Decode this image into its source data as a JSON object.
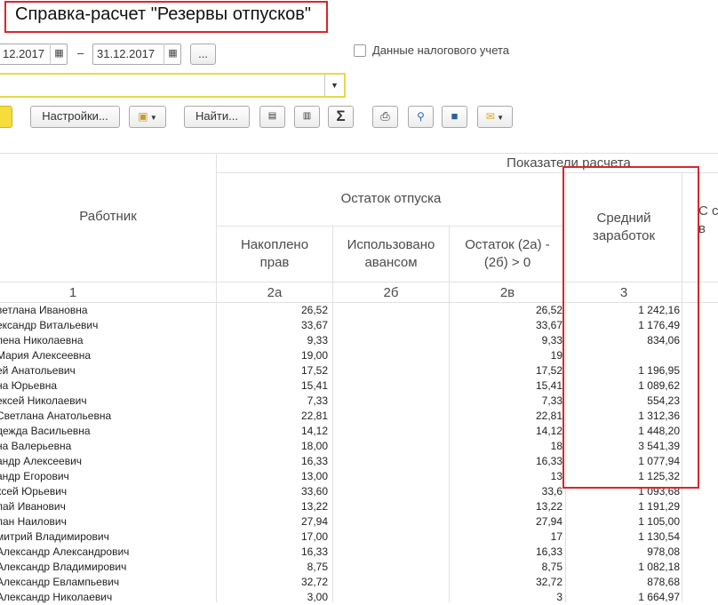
{
  "title": "Справка-расчет \"Резервы отпусков\"",
  "period": {
    "from": "12.2017",
    "dash": "–",
    "to": "31.12.2017",
    "more_label": "..."
  },
  "tax_checkbox_label": "Данные налогового учета",
  "toolbar": {
    "settings_label": "Настройки...",
    "find_label": "Найти...",
    "sum_label": "Σ"
  },
  "table": {
    "group_header": "Показатели расчета",
    "subgroup_header": "Остаток отпуска",
    "col_employee": "Работник",
    "col_accrued": "Накоплено прав",
    "col_used": "Использовано авансом",
    "col_balance": "Остаток (2а) - (2б) > 0",
    "col_avg": "Средний заработок",
    "col_cut": "С ст в",
    "num_employee": "1",
    "num_accrued": "2а",
    "num_used": "2б",
    "num_balance": "2в",
    "num_avg": "3",
    "rows": [
      {
        "name": "ветлана Ивановна",
        "accrued": "26,52",
        "balance": "26,52",
        "avg": "1 242,16"
      },
      {
        "name": "ександр Витальевич",
        "accrued": "33,67",
        "balance": "33,67",
        "avg": "1 176,49"
      },
      {
        "name": "лена Николаевна",
        "accrued": "9,33",
        "balance": "9,33",
        "avg": "834,06"
      },
      {
        "name": "Мария Алексеевна",
        "accrued": "19,00",
        "balance": "19",
        "avg": ""
      },
      {
        "name": "ей Анатольевич",
        "accrued": "17,52",
        "balance": "17,52",
        "avg": "1 196,95"
      },
      {
        "name": "на Юрьевна",
        "accrued": "15,41",
        "balance": "15,41",
        "avg": "1 089,62"
      },
      {
        "name": "ексей Николаевич",
        "accrued": "7,33",
        "balance": "7,33",
        "avg": "554,23"
      },
      {
        "name": "Светлана Анатольевна",
        "accrued": "22,81",
        "balance": "22,81",
        "avg": "1 312,36"
      },
      {
        "name": "дежда Васильевна",
        "accrued": "14,12",
        "balance": "14,12",
        "avg": "1 448,20"
      },
      {
        "name": "на Валерьевна",
        "accrued": "18,00",
        "balance": "18",
        "avg": "3 541,39"
      },
      {
        "name": "андр Алексеевич",
        "accrued": "16,33",
        "balance": "16,33",
        "avg": "1 077,94"
      },
      {
        "name": "андр Егорович",
        "accrued": "13,00",
        "balance": "13",
        "avg": "1 125,32"
      },
      {
        "name": "ксей Юрьевич",
        "accrued": "33,60",
        "balance": "33,6",
        "avg": "1 093,68"
      },
      {
        "name": "лай Иванович",
        "accrued": "13,22",
        "balance": "13,22",
        "avg": "1 191,29"
      },
      {
        "name": "лан Наилович",
        "accrued": "27,94",
        "balance": "27,94",
        "avg": "1 105,00"
      },
      {
        "name": "митрий Владимирович",
        "accrued": "17,00",
        "balance": "17",
        "avg": "1 130,54"
      },
      {
        "name": "Александр Александрович",
        "accrued": "16,33",
        "balance": "16,33",
        "avg": "978,08"
      },
      {
        "name": "Александр Владимирович",
        "accrued": "8,75",
        "balance": "8,75",
        "avg": "1 082,18"
      },
      {
        "name": "Александр Евлампьевич",
        "accrued": "32,72",
        "balance": "32,72",
        "avg": "878,68"
      },
      {
        "name": "Александр Николаевич",
        "accrued": "3,00",
        "balance": "3",
        "avg": "1 664,97"
      }
    ]
  }
}
